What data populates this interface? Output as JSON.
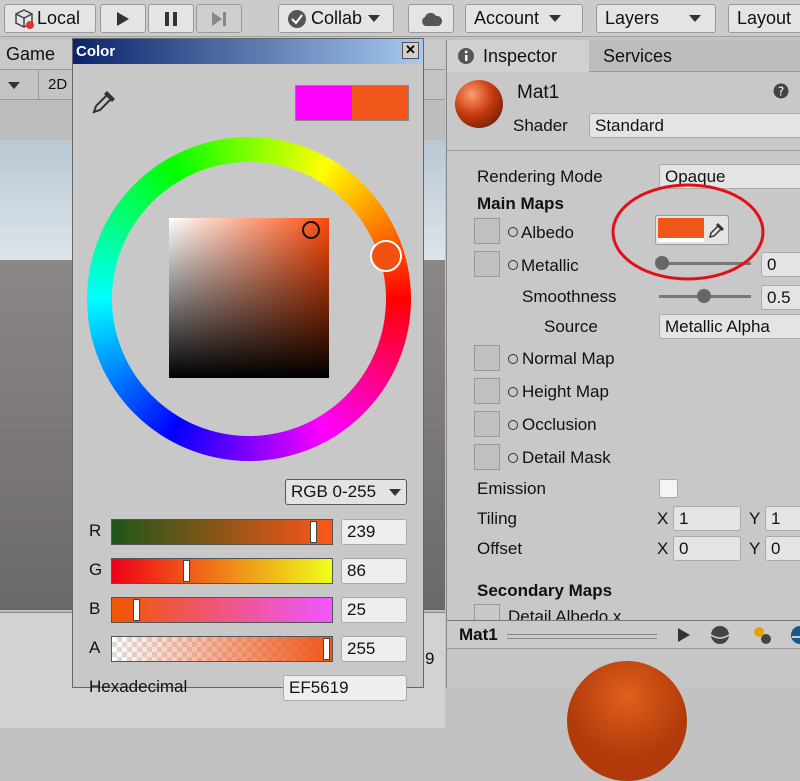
{
  "toolbar": {
    "local_label": "Local",
    "collab_label": "Collab",
    "account_label": "Account",
    "layers_label": "Layers",
    "layout_label": "Layout"
  },
  "game": {
    "tab_label": "Game",
    "mode_2d": "2D",
    "lower_value": "9"
  },
  "color_picker": {
    "title": "Color",
    "close_glyph": "✕",
    "swatch_new": "#ff00ff",
    "swatch_old": "#ef5619",
    "mode": "RGB 0-255",
    "channels": [
      {
        "label": "R",
        "value": "239",
        "fraction": 0.937
      },
      {
        "label": "G",
        "value": "86",
        "fraction": 0.337
      },
      {
        "label": "B",
        "value": "25",
        "fraction": 0.098
      },
      {
        "label": "A",
        "value": "255",
        "fraction": 1.0
      }
    ],
    "hex_label": "Hexadecimal",
    "hex_value": "EF5619"
  },
  "inspector": {
    "tab_inspector": "Inspector",
    "tab_services": "Services",
    "material_name": "Mat1",
    "shader_label": "Shader",
    "shader_value": "Standard",
    "rendering_mode_label": "Rendering Mode",
    "rendering_mode_value": "Opaque",
    "main_maps_label": "Main Maps",
    "albedo_label": "Albedo",
    "albedo_color": "#ef5619",
    "metallic_label": "Metallic",
    "metallic_value": "0",
    "smoothness_label": "Smoothness",
    "smoothness_value": "0.5",
    "source_label": "Source",
    "source_value": "Metallic Alpha",
    "normal_map_label": "Normal Map",
    "height_map_label": "Height Map",
    "occlusion_label": "Occlusion",
    "detail_mask_label": "Detail Mask",
    "emission_label": "Emission",
    "tiling_label": "Tiling",
    "tiling_x": "1",
    "tiling_y": "1",
    "offset_label": "Offset",
    "offset_x": "0",
    "offset_y": "0",
    "x_label": "X",
    "y_label": "Y",
    "secondary_maps_label": "Secondary Maps",
    "detail_albedo_label": "Detail Albedo x",
    "preview_title": "Mat1"
  },
  "annotation_color": "#e0101a"
}
